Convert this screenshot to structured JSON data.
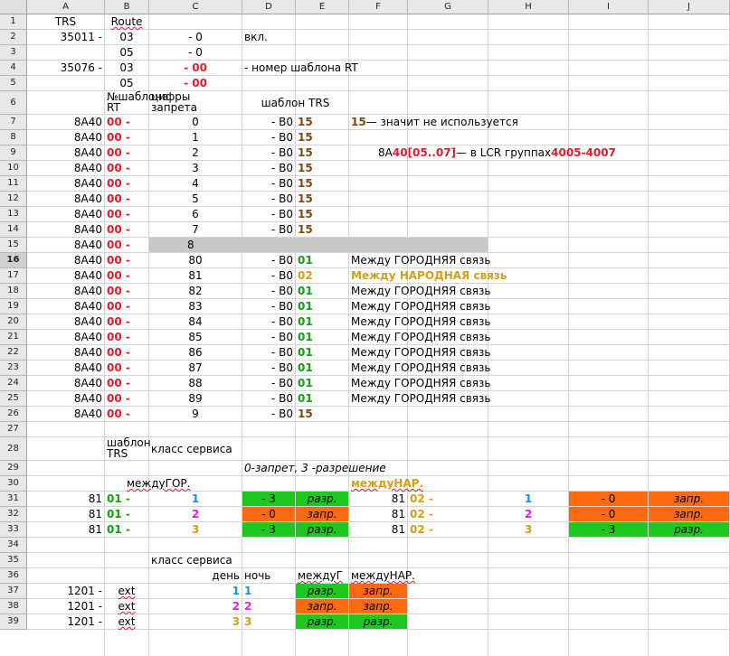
{
  "columns": [
    "A",
    "B",
    "C",
    "D",
    "E",
    "F",
    "G",
    "H",
    "I",
    "J"
  ],
  "active_row": 16,
  "colors": {
    "red": "#e8192c",
    "green": "#1fc81f",
    "orange": "#ff6a10",
    "brown": "#7b4a12",
    "gold": "#d4a017",
    "blue": "#1a8fe0",
    "magenta": "#e020e0"
  },
  "header": {
    "a1": "TRS",
    "b1": "Route",
    "d2": "вкл.",
    "c6": "цифры запрета",
    "b6": "№шаблона RT",
    "d6": "шаблон TRS",
    "e4": "- номер шаблона RT"
  },
  "top": [
    {
      "a": "35011 -",
      "b": "03",
      "c": "- 0"
    },
    {
      "a": "",
      "b": "05",
      "c": "- 0"
    },
    {
      "a": "35076 -",
      "b": "03",
      "c": "- 00"
    },
    {
      "a": "",
      "b": "05",
      "c": "- 00"
    }
  ],
  "trs_rows": [
    {
      "a": "8A40",
      "b": "00 -",
      "c": "0",
      "d": "- B0",
      "e": "15"
    },
    {
      "a": "8A40",
      "b": "00 -",
      "c": "1",
      "d": "- B0",
      "e": "15"
    },
    {
      "a": "8A40",
      "b": "00 -",
      "c": "2",
      "d": "- B0",
      "e": "15"
    },
    {
      "a": "8A40",
      "b": "00 -",
      "c": "3",
      "d": "- B0",
      "e": "15"
    },
    {
      "a": "8A40",
      "b": "00 -",
      "c": "4",
      "d": "- B0",
      "e": "15"
    },
    {
      "a": "8A40",
      "b": "00 -",
      "c": "5",
      "d": "- B0",
      "e": "15"
    },
    {
      "a": "8A40",
      "b": "00 -",
      "c": "6",
      "d": "- B0",
      "e": "15"
    },
    {
      "a": "8A40",
      "b": "00 -",
      "c": "7",
      "d": "- B0",
      "e": "15"
    },
    {
      "a": "8A40",
      "b": "00 -",
      "c": "8",
      "d": "",
      "e": ""
    },
    {
      "a": "8A40",
      "b": "00 -",
      "c": "80",
      "d": "- B0",
      "e": "01",
      "f": "Между ГОРОДНЯЯ связь"
    },
    {
      "a": "8A40",
      "b": "00 -",
      "c": "81",
      "d": "- B0",
      "e": "02",
      "f": "Между НАРОДНАЯ связь"
    },
    {
      "a": "8A40",
      "b": "00 -",
      "c": "82",
      "d": "- B0",
      "e": "01",
      "f": "Между ГОРОДНЯЯ связь"
    },
    {
      "a": "8A40",
      "b": "00 -",
      "c": "83",
      "d": "- B0",
      "e": "01",
      "f": "Между ГОРОДНЯЯ связь"
    },
    {
      "a": "8A40",
      "b": "00 -",
      "c": "84",
      "d": "- B0",
      "e": "01",
      "f": "Между ГОРОДНЯЯ связь"
    },
    {
      "a": "8A40",
      "b": "00 -",
      "c": "85",
      "d": "- B0",
      "e": "01",
      "f": "Между ГОРОДНЯЯ связь"
    },
    {
      "a": "8A40",
      "b": "00 -",
      "c": "86",
      "d": "- B0",
      "e": "01",
      "f": "Между ГОРОДНЯЯ связь"
    },
    {
      "a": "8A40",
      "b": "00 -",
      "c": "87",
      "d": "- B0",
      "e": "01",
      "f": "Между ГОРОДНЯЯ связь"
    },
    {
      "a": "8A40",
      "b": "00 -",
      "c": "88",
      "d": "- B0",
      "e": "01",
      "f": "Между ГОРОДНЯЯ связь"
    },
    {
      "a": "8A40",
      "b": "00 -",
      "c": "89",
      "d": "- B0",
      "e": "01",
      "f": "Между ГОРОДНЯЯ связь"
    },
    {
      "a": "8A40",
      "b": "00 -",
      "c": "9",
      "d": "- B0",
      "e": "15"
    }
  ],
  "notes": {
    "f7_num": "15",
    "f7_text": " — значит не используется",
    "f9_pre": "8A",
    "f9_num": "40",
    "f9_range": " [05..07]",
    "f9_mid": " — в LCR группах ",
    "f9_groups": "4005-4007"
  },
  "svc": {
    "b28": "шаблон TRS",
    "c28": "класс сервиса",
    "d29": "0-запрет, 3 -разрешение",
    "b30": "междуГОР.",
    "f30": "междуНАР.",
    "rows": [
      {
        "a": "81",
        "b": "01 -",
        "c": "1",
        "d": "- 3",
        "e": "разр.",
        "f": "81",
        "g": "02 -",
        "h": "1",
        "i": "- 0",
        "j": "запр."
      },
      {
        "a": "81",
        "b": "01 -",
        "c": "2",
        "d": "- 0",
        "e": "запр.",
        "f": "81",
        "g": "02 -",
        "h": "2",
        "i": "- 0",
        "j": "запр."
      },
      {
        "a": "81",
        "b": "01 -",
        "c": "3",
        "d": "- 3",
        "e": "разр.",
        "f": "81",
        "g": "02 -",
        "h": "3",
        "i": "- 3",
        "j": "разр."
      }
    ]
  },
  "ext": {
    "c35": "класс сервиса",
    "c36": "день",
    "d36": "ночь",
    "e36": "междуГ",
    "f36": "междуНАР.",
    "rows": [
      {
        "a": "1201 -",
        "b": "ext",
        "c": "1",
        "d": "1",
        "e": "разр.",
        "f": "запр."
      },
      {
        "a": "1201 -",
        "b": "ext",
        "c": "2",
        "d": "2",
        "e": "запр.",
        "f": "запр."
      },
      {
        "a": "1201 -",
        "b": "ext",
        "c": "3",
        "d": "3",
        "e": "разр.",
        "f": "разр."
      }
    ]
  }
}
